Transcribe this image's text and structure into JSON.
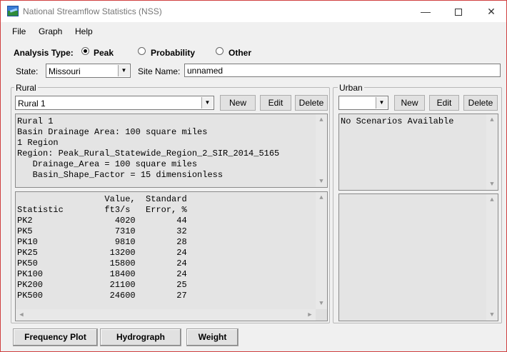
{
  "window": {
    "title": "National Streamflow Statistics (NSS)",
    "min_glyph": "—",
    "close_glyph": "✕"
  },
  "menu": [
    "File",
    "Graph",
    "Help"
  ],
  "analysis": {
    "label": "Analysis Type:",
    "options": [
      {
        "label": "Peak",
        "checked": true
      },
      {
        "label": "Probability",
        "checked": false
      },
      {
        "label": "Other",
        "checked": false
      }
    ]
  },
  "state": {
    "label": "State:",
    "value": "Missouri"
  },
  "site": {
    "label": "Site Name:",
    "value": "unnamed"
  },
  "rural": {
    "group_label": "Rural",
    "selected": "Rural 1",
    "new_label": "New",
    "edit_label": "Edit",
    "delete_label": "Delete",
    "description": "Rural 1\nBasin Drainage Area: 100 square miles\n1 Region\nRegion: Peak_Rural_Statewide_Region_2_SIR_2014_5165\n   Drainage_Area = 100 square miles\n   Basin_Shape_Factor = 15 dimensionless",
    "results_header": "                 Value,  Standard\nStatistic        ft3/s   Error, %",
    "results": [
      {
        "statistic": "PK2",
        "value": "4020",
        "error": "44"
      },
      {
        "statistic": "PK5",
        "value": "7310",
        "error": "32"
      },
      {
        "statistic": "PK10",
        "value": "9810",
        "error": "28"
      },
      {
        "statistic": "PK25",
        "value": "13200",
        "error": "24"
      },
      {
        "statistic": "PK50",
        "value": "15800",
        "error": "24"
      },
      {
        "statistic": "PK100",
        "value": "18400",
        "error": "24"
      },
      {
        "statistic": "PK200",
        "value": "21100",
        "error": "25"
      },
      {
        "statistic": "PK500",
        "value": "24600",
        "error": "27"
      }
    ]
  },
  "urban": {
    "group_label": "Urban",
    "selected": "",
    "new_label": "New",
    "edit_label": "Edit",
    "delete_label": "Delete",
    "description": "No Scenarios Available"
  },
  "bottom_buttons": {
    "frequency_plot": "Frequency Plot",
    "hydrograph": "Hydrograph",
    "weight": "Weight"
  },
  "icons": {
    "app": "nss-app-icon",
    "combo_arrow": "▼",
    "scroll_up": "▲",
    "scroll_down": "▼",
    "scroll_left": "◀",
    "scroll_right": "▶"
  }
}
